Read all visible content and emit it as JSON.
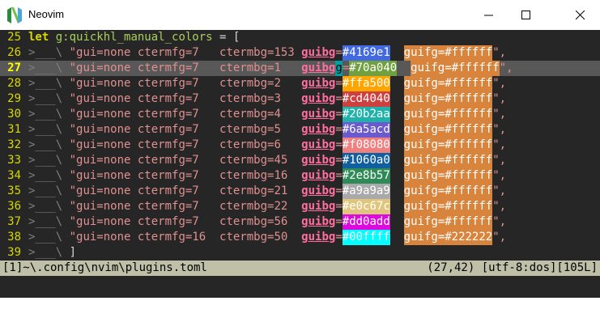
{
  "window": {
    "title": "Neovim",
    "icon": "neovim-logo-icon",
    "controls": [
      "minimize-icon",
      "maximize-icon",
      "close-icon"
    ]
  },
  "editor": {
    "first_line": {
      "number": "25",
      "keyword": "let",
      "variable": "g:quickhl_manual_colors",
      "operator": "=",
      "bracket": "["
    },
    "indent_marker": ">___\\",
    "key_label": "guibg",
    "guifg_prefix": "guifg=",
    "rows": [
      {
        "number": "26",
        "str": " \"gui=none ctermfg=7   ctermbg=153 ",
        "guibg": "#4169e1",
        "guibg_color": "#4169e1",
        "guifg": "#ffffff",
        "current": false
      },
      {
        "number": "27",
        "str": " \"gui=none ctermfg=7   ctermbg=1   ",
        "guibg": "#70a040",
        "guibg_color": "#70a040",
        "guifg": "#ffffff",
        "current": true
      },
      {
        "number": "28",
        "str": " \"gui=none ctermfg=7   ctermbg=2   ",
        "guibg": "#ffa500",
        "guibg_color": "#ffa500",
        "guifg": "#ffffff",
        "current": false
      },
      {
        "number": "29",
        "str": " \"gui=none ctermfg=7   ctermbg=3   ",
        "guibg": "#cd4040",
        "guibg_color": "#cd4040",
        "guifg": "#ffffff",
        "current": false
      },
      {
        "number": "30",
        "str": " \"gui=none ctermfg=7   ctermbg=4   ",
        "guibg": "#20b2aa",
        "guibg_color": "#20b2aa",
        "guifg": "#ffffff",
        "current": false
      },
      {
        "number": "31",
        "str": " \"gui=none ctermfg=7   ctermbg=5   ",
        "guibg": "#6a5acd",
        "guibg_color": "#6a5acd",
        "guifg": "#ffffff",
        "current": false
      },
      {
        "number": "32",
        "str": " \"gui=none ctermfg=7   ctermbg=6   ",
        "guibg": "#f08080",
        "guibg_color": "#f08080",
        "guifg": "#ffffff",
        "current": false
      },
      {
        "number": "33",
        "str": " \"gui=none ctermfg=7   ctermbg=45  ",
        "guibg": "#1060a0",
        "guibg_color": "#1060a0",
        "guifg": "#ffffff",
        "current": false
      },
      {
        "number": "34",
        "str": " \"gui=none ctermfg=7   ctermbg=16  ",
        "guibg": "#2e8b57",
        "guibg_color": "#2e8b57",
        "guifg": "#ffffff",
        "current": false
      },
      {
        "number": "35",
        "str": " \"gui=none ctermfg=7   ctermbg=21  ",
        "guibg": "#a9a9a9",
        "guibg_color": "#a9a9a9",
        "guifg": "#ffffff",
        "current": false
      },
      {
        "number": "36",
        "str": " \"gui=none ctermfg=7   ctermbg=22  ",
        "guibg": "#e0c67c",
        "guibg_color": "#e0c67c",
        "guifg": "#ffffff",
        "current": false
      },
      {
        "number": "37",
        "str": " \"gui=none ctermfg=7   ctermbg=56  ",
        "guibg": "#dd0add",
        "guibg_color": "#dd0add",
        "guifg": "#ffffff",
        "current": false
      },
      {
        "number": "38",
        "str": " \"gui=none ctermfg=16  ctermbg=50  ",
        "guibg": "#00ffff",
        "guibg_color": "#00ffff",
        "guifg": "#222222",
        "current": false
      }
    ],
    "row_suffix": "\",",
    "last_line": {
      "number": "39",
      "bracket": " ]"
    }
  },
  "statusline": {
    "left": "[1]~\\.config\\nvim\\plugins.toml",
    "right": "(27,42) [utf-8:dos][105L]"
  }
}
